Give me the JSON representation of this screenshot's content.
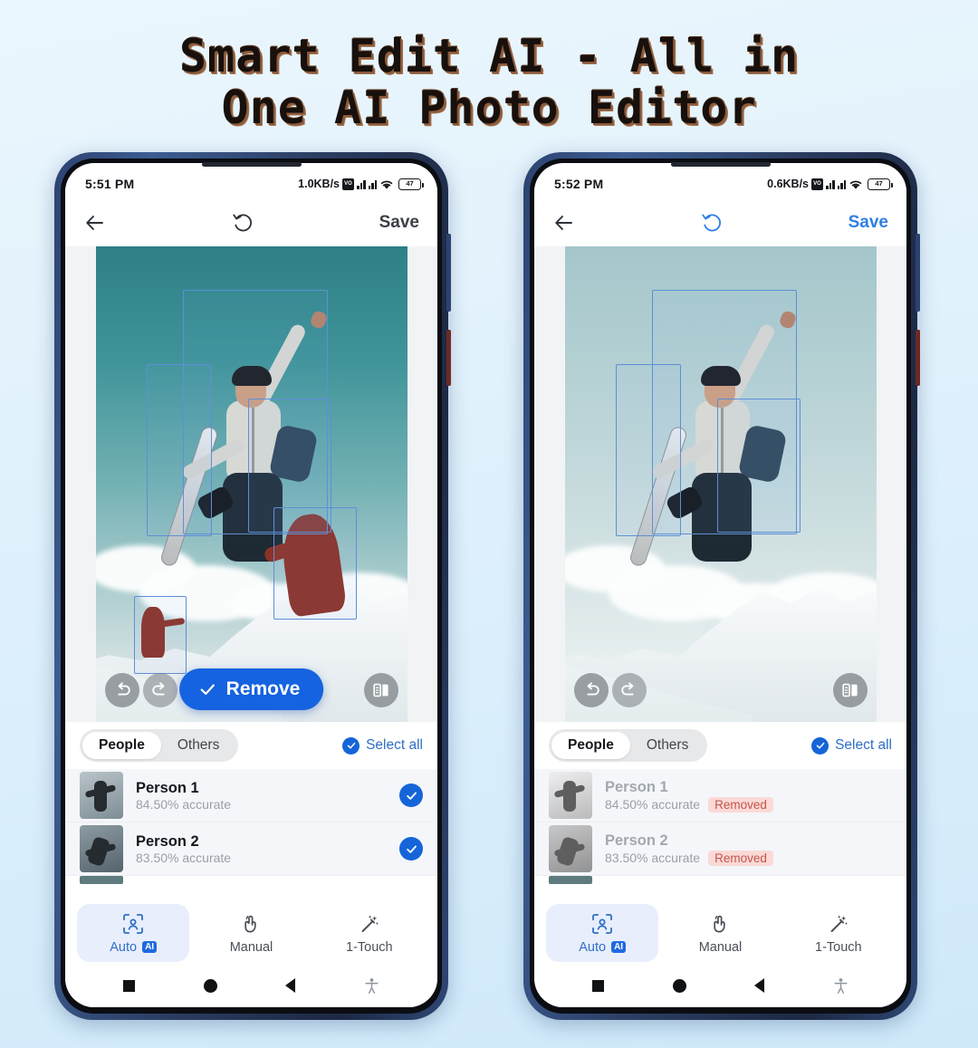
{
  "headline": {
    "line1": "Smart Edit AI - All in",
    "line2": "One AI Photo Editor"
  },
  "colors": {
    "accent_blue": "#1565d8",
    "link_blue": "#2f6fc4",
    "removed_badge_bg": "#fbd9d6",
    "removed_badge_text": "#c2564c",
    "background": "#e2f2fc"
  },
  "phones": [
    {
      "id": "before",
      "statusbar": {
        "time": "5:51 PM",
        "net_speed": "1.0KB/s",
        "vo_icon_label": "VO",
        "battery_level": "47"
      },
      "appbar": {
        "back_icon": "arrow-left-icon",
        "reset_icon": "reset-icon",
        "save_label": "Save",
        "save_color": "#3b3f46",
        "reset_color": "#2b3038"
      },
      "canvas": {
        "remove_button": {
          "label": "Remove",
          "icon": "check-icon",
          "visible": true
        },
        "undo_icon": "undo-icon",
        "redo_icon": "redo-icon",
        "compare_icon": "compare-icon",
        "people_visible": true
      },
      "tabs": {
        "items": [
          "People",
          "Others"
        ],
        "active": "People"
      },
      "select_all": {
        "label": "Select all",
        "checked": true
      },
      "people": [
        {
          "name": "Person 1",
          "accuracy": "84.50% accurate",
          "status": "",
          "checked": true
        },
        {
          "name": "Person 2",
          "accuracy": "83.50% accurate",
          "status": "",
          "checked": true
        }
      ],
      "toolbar": [
        {
          "label": "Auto",
          "icon": "auto-detect-icon",
          "badge": "AI",
          "active": true
        },
        {
          "label": "Manual",
          "icon": "hand-tap-icon",
          "badge": "",
          "active": false
        },
        {
          "label": "1-Touch",
          "icon": "magic-wand-icon",
          "badge": "",
          "active": false
        }
      ],
      "navbar": [
        "recents-square-icon",
        "home-circle-icon",
        "back-triangle-icon",
        "accessibility-icon"
      ]
    },
    {
      "id": "after",
      "statusbar": {
        "time": "5:52 PM",
        "net_speed": "0.6KB/s",
        "vo_icon_label": "VO",
        "battery_level": "47"
      },
      "appbar": {
        "back_icon": "arrow-left-icon",
        "reset_icon": "reset-icon",
        "save_label": "Save",
        "save_color": "#2f7fe4",
        "reset_color": "#2f7fe4"
      },
      "canvas": {
        "remove_button": {
          "label": "Remove",
          "icon": "check-icon",
          "visible": false
        },
        "undo_icon": "undo-icon",
        "redo_icon": "redo-icon",
        "compare_icon": "compare-icon",
        "people_visible": false
      },
      "tabs": {
        "items": [
          "People",
          "Others"
        ],
        "active": "People"
      },
      "select_all": {
        "label": "Select all",
        "checked": true
      },
      "people": [
        {
          "name": "Person 1",
          "accuracy": "84.50% accurate",
          "status": "Removed",
          "checked": false
        },
        {
          "name": "Person 2",
          "accuracy": "83.50% accurate",
          "status": "Removed",
          "checked": false
        }
      ],
      "toolbar": [
        {
          "label": "Auto",
          "icon": "auto-detect-icon",
          "badge": "AI",
          "active": true
        },
        {
          "label": "Manual",
          "icon": "hand-tap-icon",
          "badge": "",
          "active": false
        },
        {
          "label": "1-Touch",
          "icon": "magic-wand-icon",
          "badge": "",
          "active": false
        }
      ],
      "navbar": [
        "recents-square-icon",
        "home-circle-icon",
        "back-triangle-icon",
        "accessibility-icon"
      ]
    }
  ]
}
